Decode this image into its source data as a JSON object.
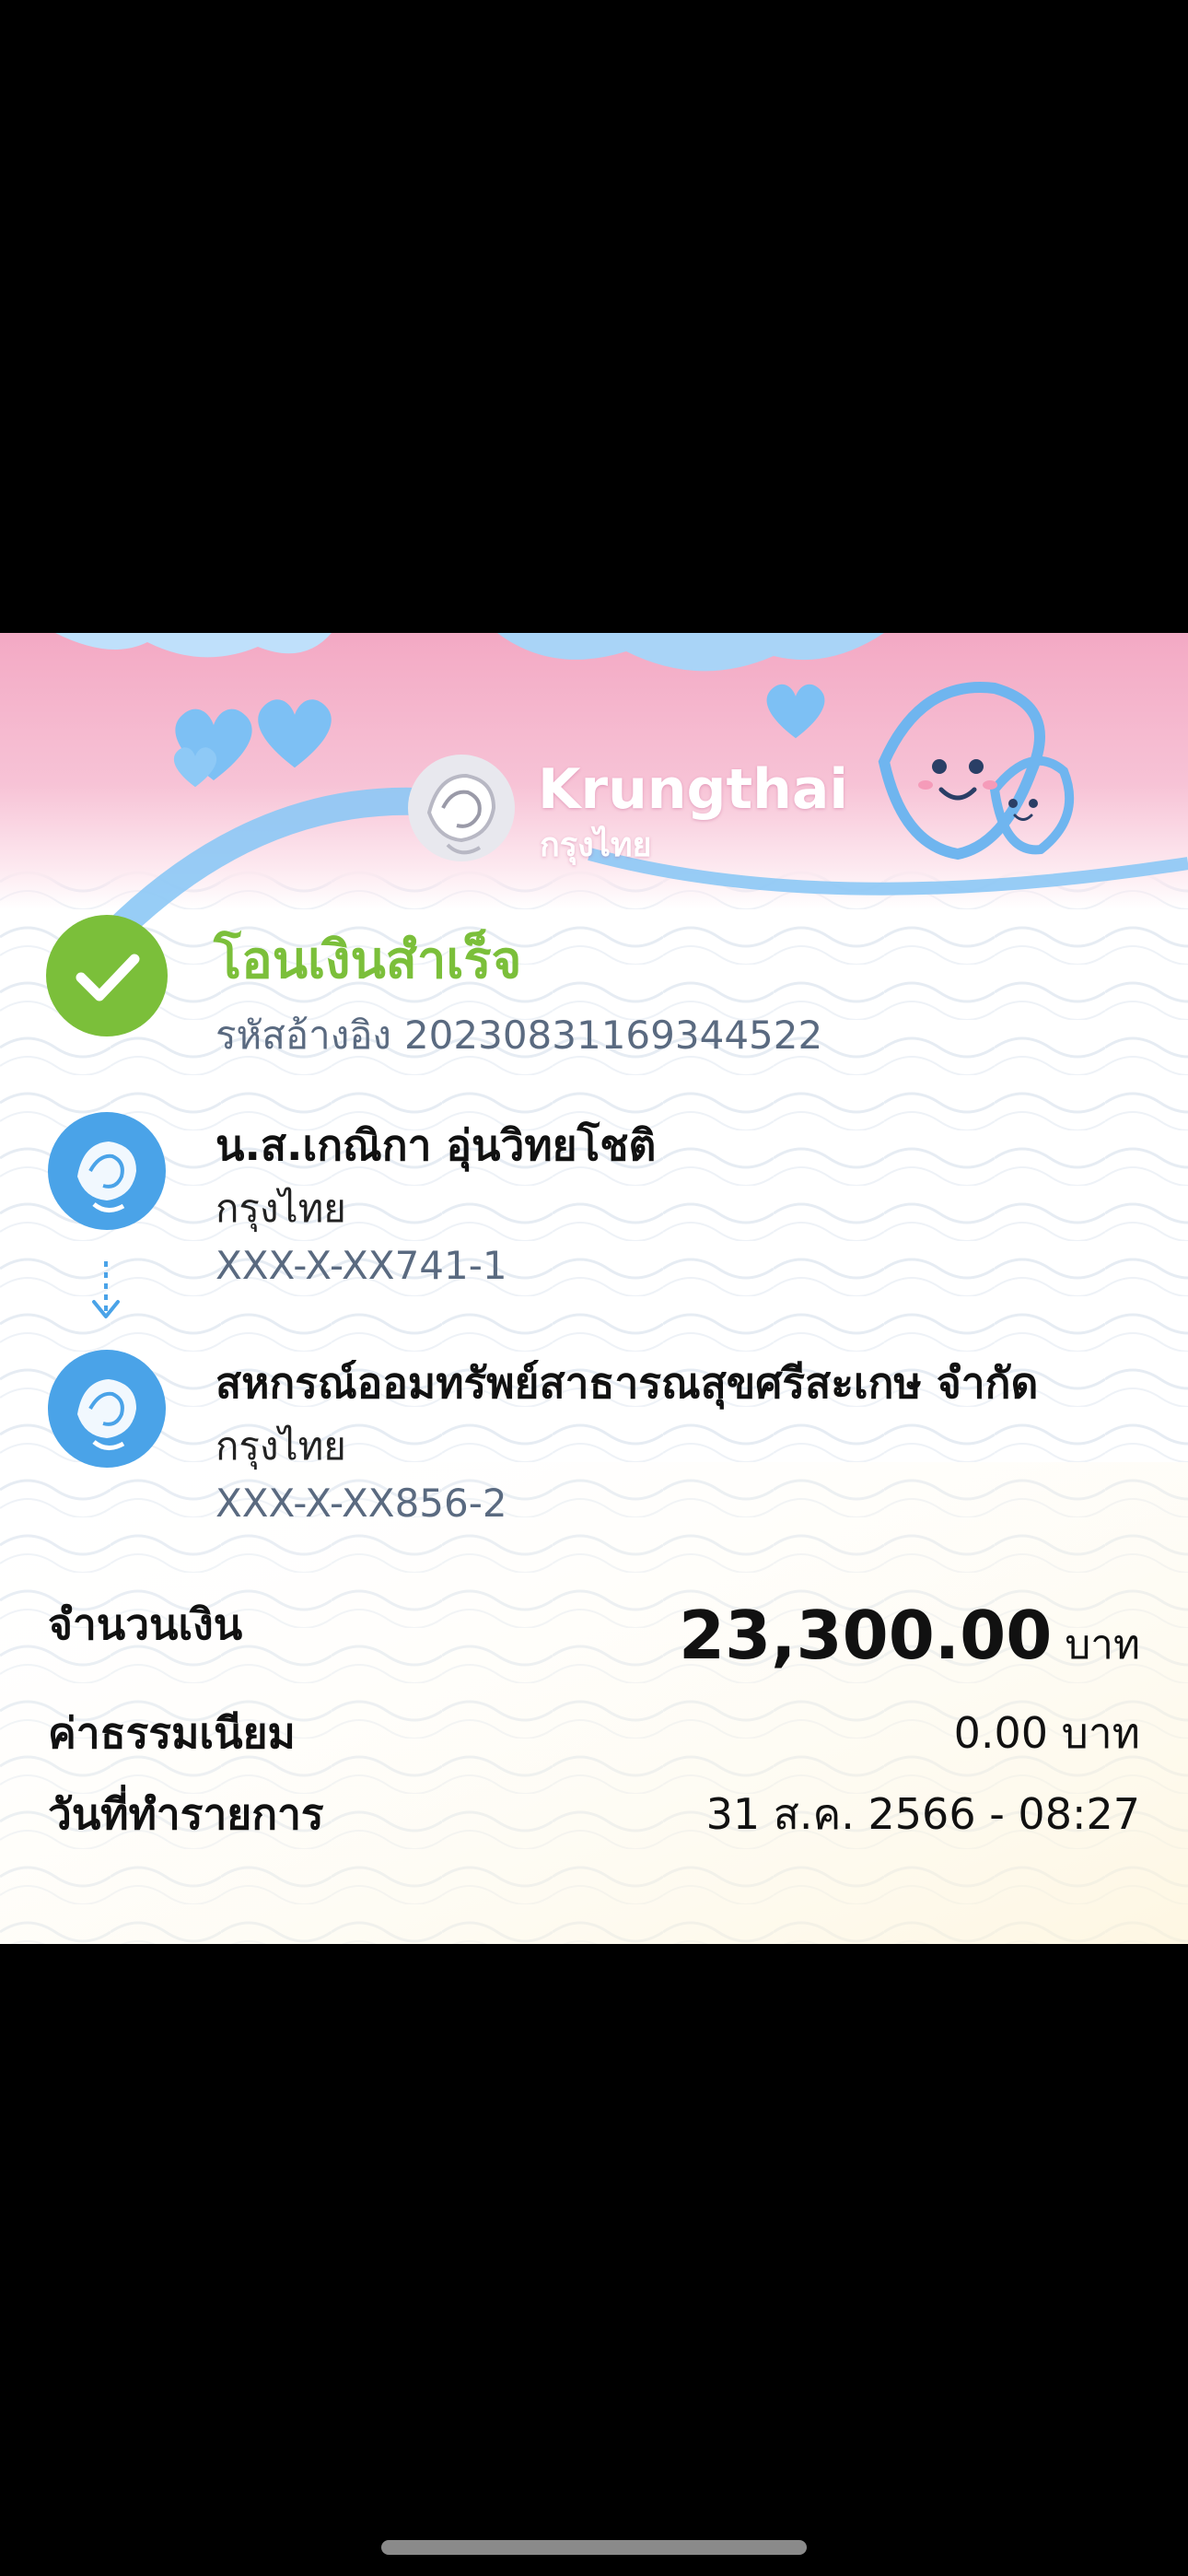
{
  "brand": {
    "name_en": "Krungthai",
    "name_th": "กรุงไทย"
  },
  "status": {
    "title": "โอนเงินสำเร็จ",
    "ref_label": "รหัสอ้างอิง",
    "ref_value": "20230831169344522",
    "icon": "check-icon"
  },
  "sender": {
    "name": "น.ส.เกณิกา อุ่นวิทยโชติ",
    "bank": "กรุงไทย",
    "account": "XXX-X-XX741-1"
  },
  "receiver": {
    "name": "สหกรณ์ออมทรัพย์สาธารณสุขศรีสะเกษ จำกัด",
    "bank": "กรุงไทย",
    "account": "XXX-X-XX856-2"
  },
  "details": {
    "amount_label": "จำนวนเงิน",
    "amount_value": "23,300.00",
    "amount_unit": "บาท",
    "fee_label": "ค่าธรรมเนียม",
    "fee_value": "0.00 บาท",
    "date_label": "วันที่ทำรายการ",
    "date_value": "31 ส.ค. 2566 - 08:27"
  },
  "colors": {
    "success_green": "#7bbf3a",
    "bank_blue": "#4aa3e8",
    "header_pink": "#f3a9c4",
    "ribbon_blue": "#8cc8f5",
    "muted_text": "#5a6a80"
  }
}
